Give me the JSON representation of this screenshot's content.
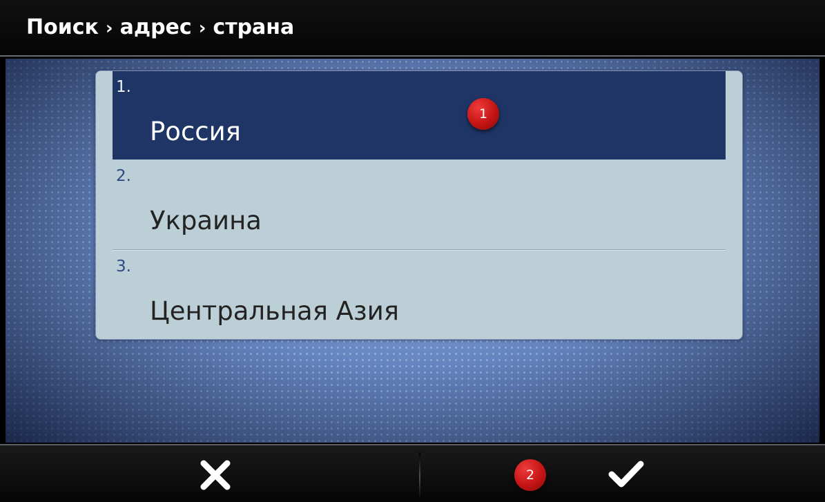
{
  "header": {
    "breadcrumb": [
      "Поиск",
      "адрес",
      "страна"
    ],
    "separator": "›"
  },
  "list": {
    "selected_index": 0,
    "items": [
      {
        "number": "1.",
        "label": "Россия"
      },
      {
        "number": "2.",
        "label": "Украина"
      },
      {
        "number": "3.",
        "label": "Центральная Азия"
      }
    ]
  },
  "callouts": {
    "badge_1": "1",
    "badge_2": "2"
  },
  "footer": {
    "cancel_icon": "close-icon",
    "confirm_icon": "checkmark-icon"
  },
  "colors": {
    "selected_row": "#1e3566",
    "panel": "#bdcfd6",
    "badge_red": "#c41414"
  }
}
